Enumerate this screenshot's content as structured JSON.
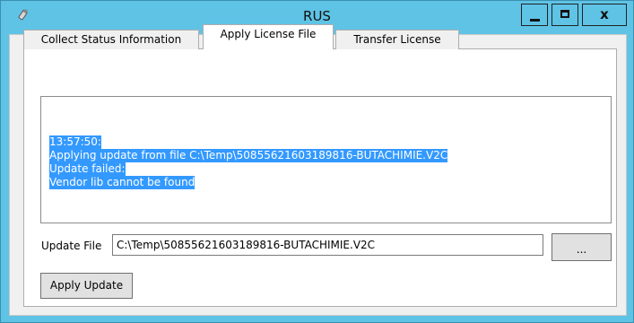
{
  "window": {
    "title": "RUS",
    "close_label": "x",
    "icon": "usb-key-icon"
  },
  "tabs": [
    {
      "label": "Collect Status Information",
      "selected": false
    },
    {
      "label": "Apply License File",
      "selected": true
    },
    {
      "label": "Transfer License",
      "selected": false
    }
  ],
  "log": {
    "lines": [
      "13:57:50:",
      "Applying update from file C:\\Temp\\50855621603189816-BUTACHIMIE.V2C",
      "Update failed:",
      "Vendor lib cannot be found"
    ],
    "selection_color": "#3399ff"
  },
  "update_file": {
    "label": "Update File",
    "value": "C:\\Temp\\50855621603189816-BUTACHIMIE.V2C"
  },
  "buttons": {
    "browse": "...",
    "apply": "Apply Update"
  },
  "colors": {
    "titlebar": "#5fc3e6",
    "client": "#f0f0f0"
  }
}
